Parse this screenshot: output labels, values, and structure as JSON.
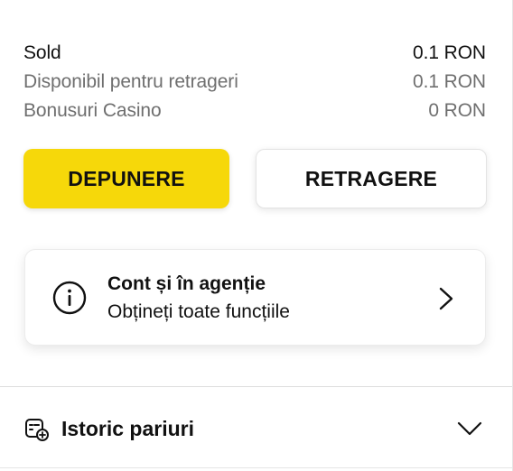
{
  "balance": {
    "rows": [
      {
        "label": "Sold",
        "value": "0.1 RON"
      },
      {
        "label": "Disponibil pentru retrageri",
        "value": "0.1 RON"
      },
      {
        "label": "Bonusuri Casino",
        "value": "0 RON"
      }
    ]
  },
  "actions": {
    "deposit_label": "DEPUNERE",
    "withdraw_label": "RETRAGERE"
  },
  "info_card": {
    "icon": "info-icon",
    "title": "Cont și în agenție",
    "subtitle": "Obțineți toate funcțiile",
    "chevron": "chevron-right-icon"
  },
  "history": {
    "icon": "bet-history-icon",
    "label": "Istoric pariuri",
    "chevron": "chevron-down-icon"
  },
  "colors": {
    "accent": "#f6d80a",
    "text": "#111111",
    "muted": "#6f6f6f"
  }
}
